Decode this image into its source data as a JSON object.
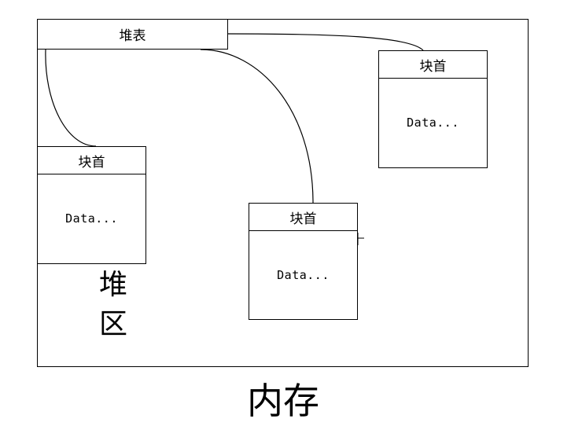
{
  "heap_table": {
    "label": "堆表"
  },
  "blocks": [
    {
      "header": "块首",
      "data": "Data..."
    },
    {
      "header": "块首",
      "data": "Data..."
    },
    {
      "header": "块首",
      "data": "Data..."
    }
  ],
  "heap_area": {
    "line1": "堆",
    "line2": "区"
  },
  "memory": {
    "label": "内存"
  }
}
